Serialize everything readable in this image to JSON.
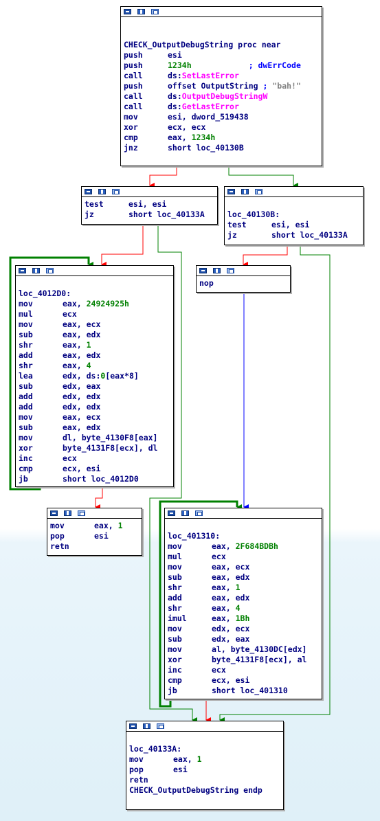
{
  "edge_colors": {
    "true": "#008000",
    "false": "#ff0000",
    "unconditional": "#0000ff"
  },
  "nodes": {
    "entry": {
      "proc_start": "CHECK_OutputDebugString proc near",
      "lines": [
        {
          "mn": "push",
          "ops": [
            {
              "t": "esi",
              "c": "reg"
            }
          ]
        },
        {
          "mn": "push",
          "ops": [
            {
              "t": "1234h",
              "c": "num"
            },
            {
              "t": "            ; dwErrCode",
              "c": "cmt"
            }
          ]
        },
        {
          "mn": "call",
          "ops": [
            {
              "t": "ds:",
              "c": "reg"
            },
            {
              "t": "SetLastError",
              "c": "fn"
            }
          ]
        },
        {
          "mn": "push",
          "ops": [
            {
              "t": "offset OutputString",
              "c": "reg"
            },
            {
              "t": " ; ",
              "c": "cmt"
            },
            {
              "t": "\"bah!\"",
              "c": "str"
            }
          ]
        },
        {
          "mn": "call",
          "ops": [
            {
              "t": "ds:",
              "c": "reg"
            },
            {
              "t": "OutputDebugStringW",
              "c": "fn"
            }
          ]
        },
        {
          "mn": "call",
          "ops": [
            {
              "t": "ds:",
              "c": "reg"
            },
            {
              "t": "GetLastError",
              "c": "fn"
            }
          ]
        },
        {
          "mn": "mov",
          "ops": [
            {
              "t": "esi, dword_519438",
              "c": "reg"
            }
          ]
        },
        {
          "mn": "xor",
          "ops": [
            {
              "t": "ecx, ecx",
              "c": "reg"
            }
          ]
        },
        {
          "mn": "cmp",
          "ops": [
            {
              "t": "eax, ",
              "c": "reg"
            },
            {
              "t": "1234h",
              "c": "num"
            }
          ]
        },
        {
          "mn": "jnz",
          "ops": [
            {
              "t": "short loc_40130B",
              "c": "reg"
            }
          ]
        }
      ]
    },
    "test_a": {
      "lines": [
        {
          "mn": "test",
          "ops": [
            {
              "t": "esi, esi",
              "c": "reg"
            }
          ]
        },
        {
          "mn": "jz",
          "ops": [
            {
              "t": "short loc_40133A",
              "c": "reg"
            }
          ]
        }
      ]
    },
    "test_b": {
      "label": "loc_40130B:",
      "lines": [
        {
          "mn": "test",
          "ops": [
            {
              "t": "esi, esi",
              "c": "reg"
            }
          ]
        },
        {
          "mn": "jz",
          "ops": [
            {
              "t": "short loc_40133A",
              "c": "reg"
            }
          ]
        }
      ]
    },
    "loop_a": {
      "label": "loc_4012D0:",
      "lines": [
        {
          "mn": "mov",
          "ops": [
            {
              "t": "eax, ",
              "c": "reg"
            },
            {
              "t": "24924925h",
              "c": "num"
            }
          ]
        },
        {
          "mn": "mul",
          "ops": [
            {
              "t": "ecx",
              "c": "reg"
            }
          ]
        },
        {
          "mn": "mov",
          "ops": [
            {
              "t": "eax, ecx",
              "c": "reg"
            }
          ]
        },
        {
          "mn": "sub",
          "ops": [
            {
              "t": "eax, edx",
              "c": "reg"
            }
          ]
        },
        {
          "mn": "shr",
          "ops": [
            {
              "t": "eax, ",
              "c": "reg"
            },
            {
              "t": "1",
              "c": "num"
            }
          ]
        },
        {
          "mn": "add",
          "ops": [
            {
              "t": "eax, edx",
              "c": "reg"
            }
          ]
        },
        {
          "mn": "shr",
          "ops": [
            {
              "t": "eax, ",
              "c": "reg"
            },
            {
              "t": "4",
              "c": "num"
            }
          ]
        },
        {
          "mn": "lea",
          "ops": [
            {
              "t": "edx, ds:",
              "c": "reg"
            },
            {
              "t": "0",
              "c": "num"
            },
            {
              "t": "[eax*8]",
              "c": "reg"
            }
          ]
        },
        {
          "mn": "sub",
          "ops": [
            {
              "t": "edx, eax",
              "c": "reg"
            }
          ]
        },
        {
          "mn": "add",
          "ops": [
            {
              "t": "edx, edx",
              "c": "reg"
            }
          ]
        },
        {
          "mn": "add",
          "ops": [
            {
              "t": "edx, edx",
              "c": "reg"
            }
          ]
        },
        {
          "mn": "mov",
          "ops": [
            {
              "t": "eax, ecx",
              "c": "reg"
            }
          ]
        },
        {
          "mn": "sub",
          "ops": [
            {
              "t": "eax, edx",
              "c": "reg"
            }
          ]
        },
        {
          "mn": "mov",
          "ops": [
            {
              "t": "dl, byte_4130F8[eax]",
              "c": "reg"
            }
          ]
        },
        {
          "mn": "xor",
          "ops": [
            {
              "t": "byte_4131F8[ecx], dl",
              "c": "reg"
            }
          ]
        },
        {
          "mn": "inc",
          "ops": [
            {
              "t": "ecx",
              "c": "reg"
            }
          ]
        },
        {
          "mn": "cmp",
          "ops": [
            {
              "t": "ecx, esi",
              "c": "reg"
            }
          ]
        },
        {
          "mn": "jb",
          "ops": [
            {
              "t": "short loc_4012D0",
              "c": "reg"
            }
          ]
        }
      ]
    },
    "nop_block": {
      "lines": [
        {
          "mn": "nop",
          "ops": []
        }
      ]
    },
    "ret_a": {
      "lines": [
        {
          "mn": "mov",
          "ops": [
            {
              "t": "eax, ",
              "c": "reg"
            },
            {
              "t": "1",
              "c": "num"
            }
          ]
        },
        {
          "mn": "pop",
          "ops": [
            {
              "t": "esi",
              "c": "reg"
            }
          ]
        },
        {
          "mn": "retn",
          "ops": []
        }
      ]
    },
    "loop_b": {
      "label": "loc_401310:",
      "lines": [
        {
          "mn": "mov",
          "ops": [
            {
              "t": "eax, ",
              "c": "reg"
            },
            {
              "t": "2F684BDBh",
              "c": "num"
            }
          ]
        },
        {
          "mn": "mul",
          "ops": [
            {
              "t": "ecx",
              "c": "reg"
            }
          ]
        },
        {
          "mn": "mov",
          "ops": [
            {
              "t": "eax, ecx",
              "c": "reg"
            }
          ]
        },
        {
          "mn": "sub",
          "ops": [
            {
              "t": "eax, edx",
              "c": "reg"
            }
          ]
        },
        {
          "mn": "shr",
          "ops": [
            {
              "t": "eax, ",
              "c": "reg"
            },
            {
              "t": "1",
              "c": "num"
            }
          ]
        },
        {
          "mn": "add",
          "ops": [
            {
              "t": "eax, edx",
              "c": "reg"
            }
          ]
        },
        {
          "mn": "shr",
          "ops": [
            {
              "t": "eax, ",
              "c": "reg"
            },
            {
              "t": "4",
              "c": "num"
            }
          ]
        },
        {
          "mn": "imul",
          "ops": [
            {
              "t": "eax, ",
              "c": "reg"
            },
            {
              "t": "1Bh",
              "c": "num"
            }
          ]
        },
        {
          "mn": "mov",
          "ops": [
            {
              "t": "edx, ecx",
              "c": "reg"
            }
          ]
        },
        {
          "mn": "sub",
          "ops": [
            {
              "t": "edx, eax",
              "c": "reg"
            }
          ]
        },
        {
          "mn": "mov",
          "ops": [
            {
              "t": "al, byte_4130DC[edx]",
              "c": "reg"
            }
          ]
        },
        {
          "mn": "xor",
          "ops": [
            {
              "t": "byte_4131F8[ecx], al",
              "c": "reg"
            }
          ]
        },
        {
          "mn": "inc",
          "ops": [
            {
              "t": "ecx",
              "c": "reg"
            }
          ]
        },
        {
          "mn": "cmp",
          "ops": [
            {
              "t": "ecx, esi",
              "c": "reg"
            }
          ]
        },
        {
          "mn": "jb",
          "ops": [
            {
              "t": "short loc_401310",
              "c": "reg"
            }
          ]
        }
      ]
    },
    "exit": {
      "label": "loc_40133A:",
      "lines": [
        {
          "mn": "mov",
          "ops": [
            {
              "t": "eax, ",
              "c": "reg"
            },
            {
              "t": "1",
              "c": "num"
            }
          ]
        },
        {
          "mn": "pop",
          "ops": [
            {
              "t": "esi",
              "c": "reg"
            }
          ]
        },
        {
          "mn": "retn",
          "ops": []
        }
      ],
      "proc_end": "CHECK_OutputDebugString endp"
    }
  }
}
